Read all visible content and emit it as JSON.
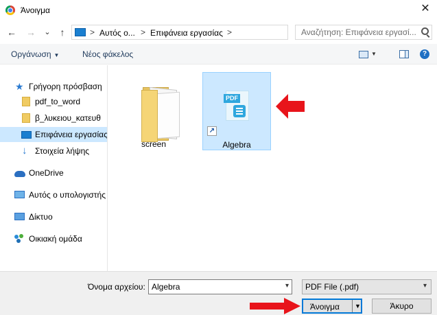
{
  "window": {
    "title": "Άνοιγμα",
    "close_glyph": "✕"
  },
  "nav": {
    "back_glyph": "←",
    "forward_glyph": "→",
    "recent_glyph": "⌄",
    "up_glyph": "↑",
    "breadcrumbs": [
      "Αυτός ο...",
      "Επιφάνεια εργασίας"
    ],
    "separator": ">",
    "search_placeholder": "Αναζήτηση: Επιφάνεια εργασί..."
  },
  "toolbar": {
    "organize_label": "Οργάνωση",
    "new_folder_label": "Νέος φάκελος",
    "help_glyph": "?"
  },
  "sidebar": {
    "items": [
      {
        "label": "Γρήγορη πρόσβαση",
        "icon": "star-icon"
      },
      {
        "label": "pdf_to_word",
        "icon": "folder-icon"
      },
      {
        "label": "β_λυκειου_κατευθ",
        "icon": "folder-icon"
      },
      {
        "label": "Επιφάνεια εργασίας",
        "icon": "desktop-icon"
      },
      {
        "label": "Στοιχεία λήψης",
        "icon": "download-icon"
      },
      {
        "label": "OneDrive",
        "icon": "cloud-icon"
      },
      {
        "label": "Αυτός ο υπολογιστής",
        "icon": "computer-icon"
      },
      {
        "label": "Δίκτυο",
        "icon": "network-icon"
      },
      {
        "label": "Οικιακή ομάδα",
        "icon": "homegroup-icon"
      }
    ]
  },
  "files": [
    {
      "name": "screen",
      "type": "folder"
    },
    {
      "name": "Algebra",
      "type": "pdf-shortcut",
      "badge": "PDF"
    }
  ],
  "bottom": {
    "filename_label": "Όνομα αρχείου:",
    "filename_value": "Algebra",
    "filetype_value": "PDF File (.pdf)",
    "open_label": "Άνοιγμα",
    "cancel_label": "Άκυρο"
  },
  "colors": {
    "selection": "#cce8ff",
    "accent": "#0078d7",
    "arrow": "#e8141b"
  }
}
